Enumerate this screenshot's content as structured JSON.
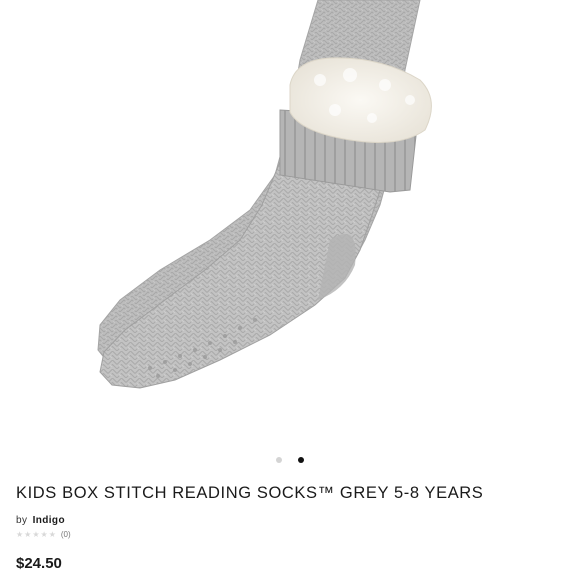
{
  "gallery": {
    "image_alt": "Kids Box Stitch Reading Socks Grey",
    "dots": [
      {
        "active": false
      },
      {
        "active": true
      }
    ]
  },
  "product": {
    "title": "KIDS BOX STITCH READING SOCKS™ GREY 5-8 YEARS",
    "by_label": "by",
    "brand": "Indigo",
    "stars": "★★★★★",
    "review_count": "(0)",
    "price": "$24.50"
  },
  "colors": {
    "sock_grey": "#b9b9b9",
    "sock_shadow": "#9c9c9c",
    "sherpa": "#f4f1ea",
    "active_dot": "#111111",
    "inactive_dot": "#d4d4d4"
  }
}
